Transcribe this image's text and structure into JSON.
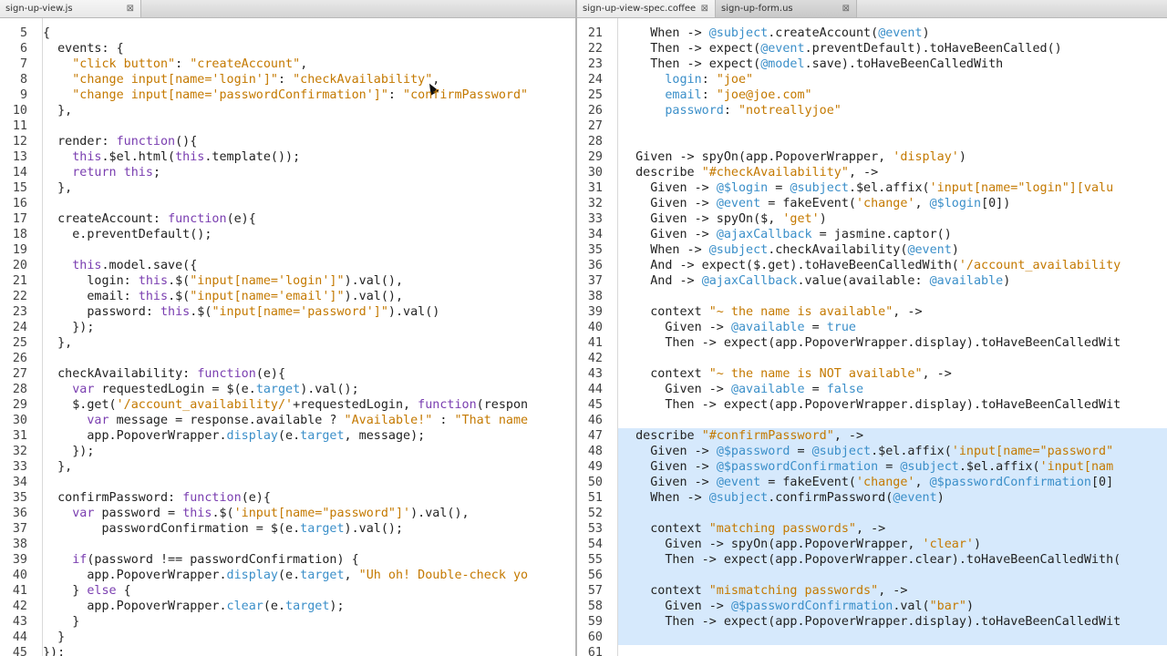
{
  "tabs_left": [
    {
      "label": "sign-up-view.js",
      "active": true
    }
  ],
  "tabs_right": [
    {
      "label": "sign-up-view-spec.coffee",
      "active": true
    },
    {
      "label": "sign-up-form.us",
      "active": false
    }
  ],
  "tab_close_glyph": "⊠",
  "left_pane": {
    "lines": [
      {
        "n": "5",
        "t": "{"
      },
      {
        "n": "6",
        "t": "  events: {"
      },
      {
        "n": "7",
        "t": "    \"click button\": \"createAccount\","
      },
      {
        "n": "8",
        "t": "    \"change input[name='login']\": \"checkAvailability\","
      },
      {
        "n": "9",
        "t": "    \"change input[name='passwordConfirmation']\": \"confirmPassword\""
      },
      {
        "n": "10",
        "t": "  },"
      },
      {
        "n": "11",
        "t": ""
      },
      {
        "n": "12",
        "t": "  render: function(){"
      },
      {
        "n": "13",
        "t": "    this.$el.html(this.template());"
      },
      {
        "n": "14",
        "t": "    return this;"
      },
      {
        "n": "15",
        "t": "  },"
      },
      {
        "n": "16",
        "t": ""
      },
      {
        "n": "17",
        "t": "  createAccount: function(e){"
      },
      {
        "n": "18",
        "t": "    e.preventDefault();"
      },
      {
        "n": "19",
        "t": ""
      },
      {
        "n": "20",
        "t": "    this.model.save({"
      },
      {
        "n": "21",
        "t": "      login: this.$(\"input[name='login']\").val(),"
      },
      {
        "n": "22",
        "t": "      email: this.$(\"input[name='email']\").val(),"
      },
      {
        "n": "23",
        "t": "      password: this.$(\"input[name='password']\").val()"
      },
      {
        "n": "24",
        "t": "    });"
      },
      {
        "n": "25",
        "t": "  },"
      },
      {
        "n": "26",
        "t": ""
      },
      {
        "n": "27",
        "t": "  checkAvailability: function(e){"
      },
      {
        "n": "28",
        "t": "    var requestedLogin = $(e.target).val();"
      },
      {
        "n": "29",
        "t": "    $.get('/account_availability/'+requestedLogin, function(respon"
      },
      {
        "n": "30",
        "t": "      var message = response.available ? \"Available!\" : \"That name"
      },
      {
        "n": "31",
        "t": "      app.PopoverWrapper.display(e.target, message);"
      },
      {
        "n": "32",
        "t": "    });"
      },
      {
        "n": "33",
        "t": "  },"
      },
      {
        "n": "34",
        "t": ""
      },
      {
        "n": "35",
        "t": "  confirmPassword: function(e){"
      },
      {
        "n": "36",
        "t": "    var password = this.$('input[name=\"password\"]').val(),"
      },
      {
        "n": "37",
        "t": "        passwordConfirmation = $(e.target).val();"
      },
      {
        "n": "38",
        "t": ""
      },
      {
        "n": "39",
        "t": "    if(password !== passwordConfirmation) {"
      },
      {
        "n": "40",
        "t": "      app.PopoverWrapper.display(e.target, \"Uh oh! Double-check yo"
      },
      {
        "n": "41",
        "t": "    } else {"
      },
      {
        "n": "42",
        "t": "      app.PopoverWrapper.clear(e.target);"
      },
      {
        "n": "43",
        "t": "    }"
      },
      {
        "n": "44",
        "t": "  }"
      },
      {
        "n": "45",
        "t": "});"
      }
    ]
  },
  "right_pane": {
    "lines": [
      {
        "n": "21",
        "t": "    When -> @subject.createAccount(@event)"
      },
      {
        "n": "22",
        "t": "    Then -> expect(@event.preventDefault).toHaveBeenCalled()"
      },
      {
        "n": "23",
        "t": "    Then -> expect(@model.save).toHaveBeenCalledWith"
      },
      {
        "n": "24",
        "t": "      login: \"joe\""
      },
      {
        "n": "25",
        "t": "      email: \"joe@joe.com\""
      },
      {
        "n": "26",
        "t": "      password: \"notreallyjoe\""
      },
      {
        "n": "27",
        "t": ""
      },
      {
        "n": "28",
        "t": ""
      },
      {
        "n": "29",
        "t": "  Given -> spyOn(app.PopoverWrapper, 'display')"
      },
      {
        "n": "30",
        "t": "  describe \"#checkAvailability\", ->"
      },
      {
        "n": "31",
        "t": "    Given -> @$login = @subject.$el.affix('input[name=\"login\"][valu"
      },
      {
        "n": "32",
        "t": "    Given -> @event = fakeEvent('change', @$login[0])"
      },
      {
        "n": "33",
        "t": "    Given -> spyOn($, 'get')"
      },
      {
        "n": "34",
        "t": "    Given -> @ajaxCallback = jasmine.captor()"
      },
      {
        "n": "35",
        "t": "    When -> @subject.checkAvailability(@event)"
      },
      {
        "n": "36",
        "t": "    And -> expect($.get).toHaveBeenCalledWith('/account_availability"
      },
      {
        "n": "37",
        "t": "    And -> @ajaxCallback.value(available: @available)"
      },
      {
        "n": "38",
        "t": ""
      },
      {
        "n": "39",
        "t": "    context \"~ the name is available\", ->"
      },
      {
        "n": "40",
        "t": "      Given -> @available = true"
      },
      {
        "n": "41",
        "t": "      Then -> expect(app.PopoverWrapper.display).toHaveBeenCalledWit"
      },
      {
        "n": "42",
        "t": ""
      },
      {
        "n": "43",
        "t": "    context \"~ the name is NOT available\", ->"
      },
      {
        "n": "44",
        "t": "      Given -> @available = false"
      },
      {
        "n": "45",
        "t": "      Then -> expect(app.PopoverWrapper.display).toHaveBeenCalledWit"
      },
      {
        "n": "46",
        "t": ""
      },
      {
        "n": "47",
        "t": "  describe \"#confirmPassword\", ->"
      },
      {
        "n": "48",
        "t": "    Given -> @$password = @subject.$el.affix('input[name=\"password\""
      },
      {
        "n": "49",
        "t": "    Given -> @$passwordConfirmation = @subject.$el.affix('input[nam"
      },
      {
        "n": "50",
        "t": "    Given -> @event = fakeEvent('change', @$passwordConfirmation[0]"
      },
      {
        "n": "51",
        "t": "    When -> @subject.confirmPassword(@event)"
      },
      {
        "n": "52",
        "t": ""
      },
      {
        "n": "53",
        "t": "    context \"matching passwords\", ->"
      },
      {
        "n": "54",
        "t": "      Given -> spyOn(app.PopoverWrapper, 'clear')"
      },
      {
        "n": "55",
        "t": "      Then -> expect(app.PopoverWrapper.clear).toHaveBeenCalledWith("
      },
      {
        "n": "56",
        "t": ""
      },
      {
        "n": "57",
        "t": "    context \"mismatching passwords\", ->"
      },
      {
        "n": "58",
        "t": "      Given -> @$passwordConfirmation.val(\"bar\")"
      },
      {
        "n": "59",
        "t": "      Then -> expect(app.PopoverWrapper.display).toHaveBeenCalledWit"
      },
      {
        "n": "60",
        "t": ""
      },
      {
        "n": "61",
        "t": ""
      }
    ],
    "selection_color": "#d6e9fc"
  },
  "colors": {
    "string": "#c47900",
    "keyword": "#7a3eb0",
    "variable": "#3b8fc9",
    "text": "#222222",
    "line_number": "#444444"
  }
}
